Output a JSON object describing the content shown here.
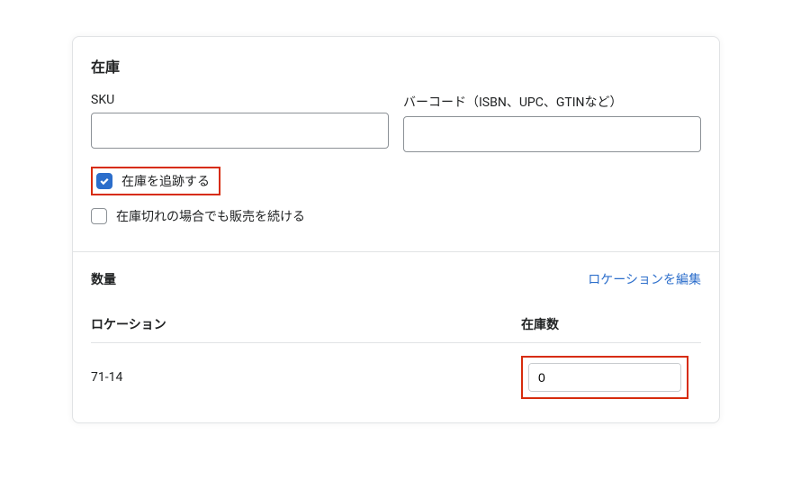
{
  "inventory": {
    "section_title": "在庫",
    "sku_label": "SKU",
    "sku_value": "",
    "barcode_label": "バーコード（ISBN、UPC、GTINなど）",
    "barcode_value": "",
    "track_inventory_label": "在庫を追跡する",
    "track_inventory_checked": true,
    "oversell_label": "在庫切れの場合でも販売を続ける",
    "oversell_checked": false
  },
  "quantity": {
    "section_title": "数量",
    "edit_locations_link": "ロケーションを編集",
    "location_header": "ロケーション",
    "stock_header": "在庫数",
    "rows": [
      {
        "location": "71-14",
        "stock": "0"
      }
    ]
  }
}
